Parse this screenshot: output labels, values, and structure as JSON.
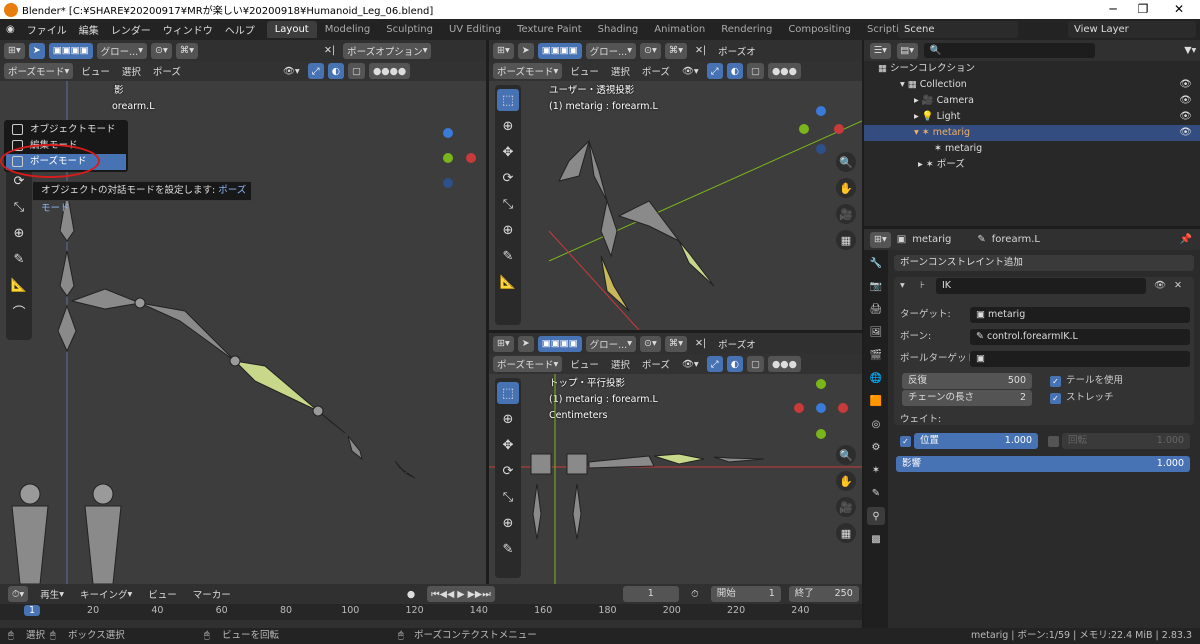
{
  "window": {
    "title": "Blender* [C:¥SHARE¥20200917¥MRが楽しい¥20200918¥Humanoid_Leg_06.blend]"
  },
  "menus": [
    "ファイル",
    "編集",
    "レンダー",
    "ウィンドウ",
    "ヘルプ"
  ],
  "workspaces": [
    "Layout",
    "Modeling",
    "Sculpting",
    "UV Editing",
    "Texture Paint",
    "Shading",
    "Animation",
    "Rendering",
    "Compositing",
    "Scripting"
  ],
  "scene": "Scene",
  "view_layer": "View Layer",
  "viewport_left": {
    "mode": "ポーズモード",
    "view": "ビュー",
    "select": "選択",
    "pose": "ポーズ",
    "transform": "グロー...",
    "options": "ポーズオプション",
    "overlay_1": "影",
    "overlay_2": "orearm.L"
  },
  "mode_menu": {
    "items": [
      "オブジェクトモード",
      "編集モード",
      "ポーズモード"
    ],
    "tooltip_prefix": "オブジェクトの対話モードを設定します: ",
    "tooltip_value": "ポーズモード"
  },
  "viewport_tr": {
    "mode": "ポーズモード",
    "view": "ビュー",
    "select": "選択",
    "pose": "ポーズ",
    "transform": "グロー...",
    "options": "ポーズオ",
    "line1": "ユーザー・透視投影",
    "line2": "(1) metarig : forearm.L"
  },
  "viewport_br": {
    "mode": "ポーズモード",
    "view": "ビュー",
    "select": "選択",
    "pose": "ポーズ",
    "transform": "グロー...",
    "options": "ポーズオ",
    "line1": "トップ・平行投影",
    "line2": "(1) metarig : forearm.L",
    "line3": "Centimeters"
  },
  "outliner": {
    "root": "シーンコレクション",
    "rows": [
      {
        "label": "Collection",
        "indent": 1
      },
      {
        "label": "Camera",
        "indent": 2
      },
      {
        "label": "Light",
        "indent": 2
      },
      {
        "label": "metarig",
        "indent": 2
      },
      {
        "label": "metarig",
        "indent": 3
      },
      {
        "label": "ポーズ",
        "indent": 3
      }
    ]
  },
  "properties": {
    "object": "metarig",
    "bone": "forearm.L",
    "add_constraint": "ボーンコンストレイント追加",
    "constraint_name": "IK",
    "target_label": "ターゲット:",
    "target_value": "metarig",
    "bone_label": "ボーン:",
    "bone_value": "control.forearmIK.L",
    "pole_label": "ポールターゲット:",
    "iterations_label": "反復",
    "iterations_value": "500",
    "chain_label": "チェーンの長さ",
    "chain_value": "2",
    "use_tail": "テールを使用",
    "stretch": "ストレッチ",
    "weight_label": "ウェイト:",
    "position_label": "位置",
    "position_value": "1.000",
    "rotation_label": "回転",
    "rotation_value": "1.000",
    "influence_label": "影響",
    "influence_value": "1.000"
  },
  "timeline": {
    "playback": "再生",
    "keying": "キーイング",
    "view": "ビュー",
    "marker": "マーカー",
    "current_frame": "1",
    "start_label": "開始",
    "start_value": "1",
    "end_label": "終了",
    "end_value": "250",
    "ticks": [
      "1",
      "20",
      "40",
      "60",
      "80",
      "100",
      "120",
      "140",
      "160",
      "180",
      "200",
      "220",
      "240"
    ]
  },
  "statusbar": {
    "select": "選択",
    "box_select": "ボックス選択",
    "rotate_view": "ビューを回転",
    "context_menu": "ポーズコンテクストメニュー",
    "stats": "metarig | ボーン:1/59 | メモリ:22.4 MiB | 2.83.3"
  },
  "colors": {
    "accent": "#4772b3",
    "bone_selected": "#c8d88a",
    "x_axis": "#c93a3a",
    "y_axis": "#7bb51c",
    "z_axis": "#3a7ad9"
  }
}
